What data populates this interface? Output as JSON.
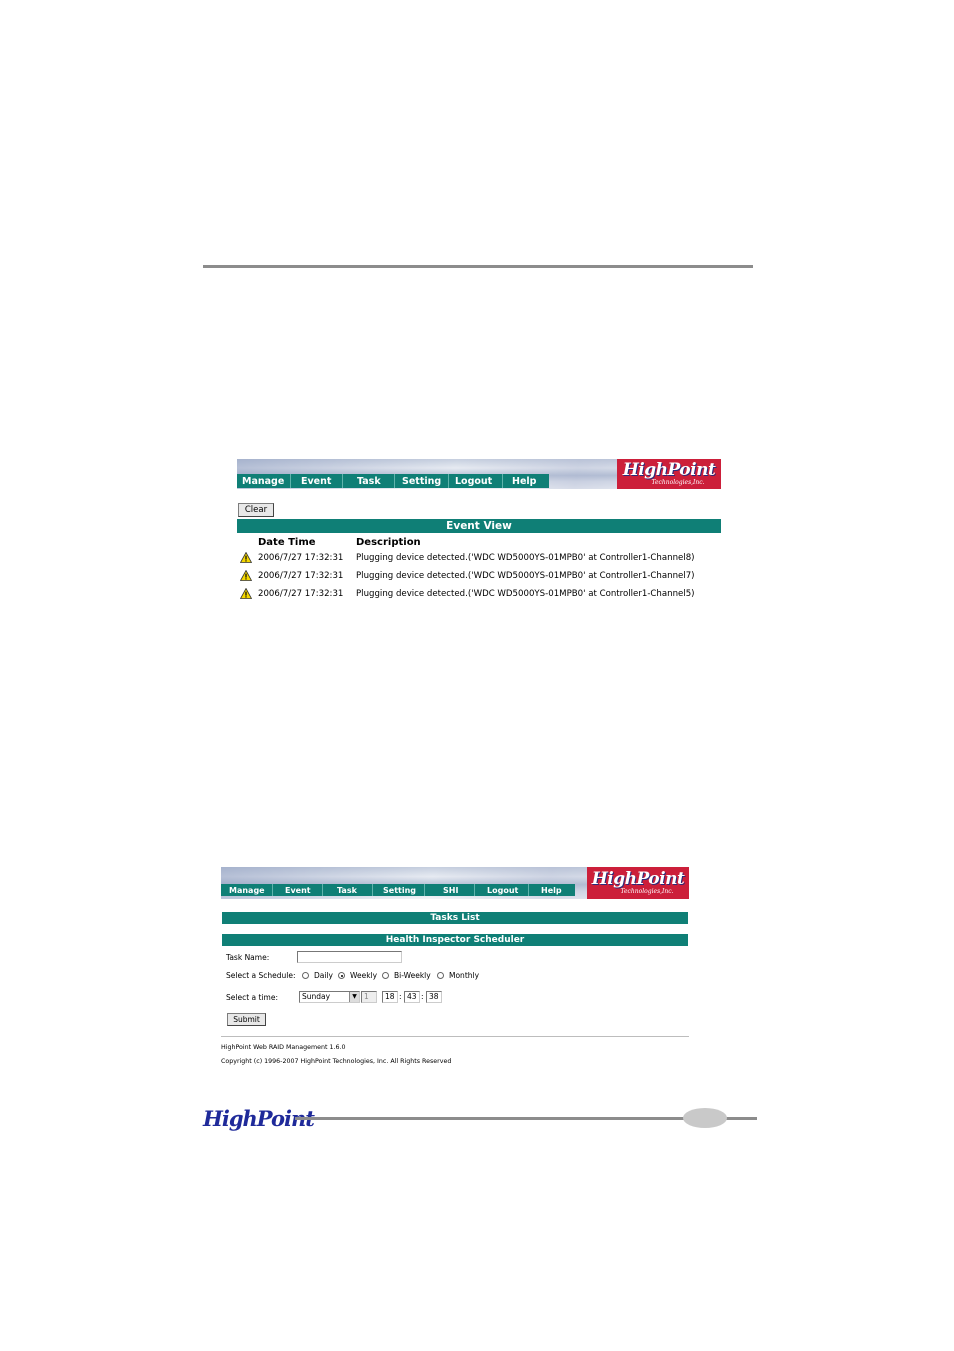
{
  "screen1": {
    "logo": {
      "main": "HighPoint",
      "sub": "Technologies,Inc."
    },
    "nav": [
      "Manage",
      "Event",
      "Task",
      "Setting",
      "Logout",
      "Help"
    ],
    "clear_label": "Clear",
    "event_view_title": "Event View",
    "columns": {
      "datetime": "Date Time",
      "description": "Description"
    },
    "events": [
      {
        "datetime": "2006/7/27 17:32:31",
        "description": "Plugging device detected.('WDC WD5000YS-01MPB0' at Controller1-Channel8)"
      },
      {
        "datetime": "2006/7/27 17:32:31",
        "description": "Plugging device detected.('WDC WD5000YS-01MPB0' at Controller1-Channel7)"
      },
      {
        "datetime": "2006/7/27 17:32:31",
        "description": "Plugging device detected.('WDC WD5000YS-01MPB0' at Controller1-Channel5)"
      }
    ]
  },
  "screen2": {
    "logo": {
      "main": "HighPoint",
      "sub": "Technologies,Inc."
    },
    "nav": [
      "Manage",
      "Event",
      "Task",
      "Setting",
      "SHI",
      "Logout",
      "Help"
    ],
    "tasks_list_title": "Tasks List",
    "scheduler_title": "Health Inspector Scheduler",
    "task_name_label": "Task Name:",
    "task_name_value": "",
    "schedule_label": "Select a Schedule:",
    "schedule_options": [
      "Daily",
      "Weekly",
      "Bi-Weekly",
      "Monthly"
    ],
    "schedule_selected": "Weekly",
    "time_label": "Select a time:",
    "day_value": "Sunday",
    "day_number": "1",
    "hour": "18",
    "minute": "43",
    "second": "38",
    "time_sep": ":",
    "submit_label": "Submit",
    "footer_line1": "HighPoint Web RAID Management 1.6.0",
    "footer_line2": "Copyright (c) 1996-2007 HighPoint Technologies, Inc. All Rights Reserved"
  },
  "page_footer": {
    "logo": "HighPoint"
  },
  "colors": {
    "teal": "#0f7f76",
    "logo_red": "#cc1f3a",
    "rule_gray": "#8c8c8c"
  }
}
